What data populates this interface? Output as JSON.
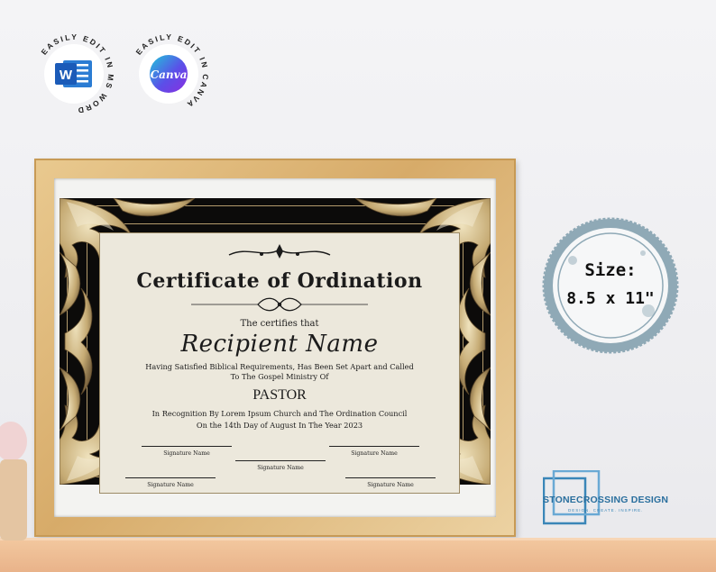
{
  "badges": [
    {
      "text": "EASILY EDIT IN MS WORD",
      "icon": "word-icon",
      "color": "#1f5fc4"
    },
    {
      "text": "EASILY EDIT IN CANVA",
      "icon": "canva-icon",
      "label": "Canva",
      "color": "#7a3ae0"
    }
  ],
  "certificate": {
    "title": "Certificate of Ordination",
    "certifies": "The certifies that",
    "recipient": "Recipient Name",
    "body_line1": "Having Satisfied Biblical Requirements, Has Been Set Apart and Called",
    "body_line2": "To The Gospel Ministry Of",
    "office": "PASTOR",
    "recognition_line1": "In Recognition By Lorem Ipsum Church and The Ordination Council",
    "recognition_line2": "On the 14th Day of August In The Year 2023",
    "signatures": [
      "Signature Name",
      "Signature Name",
      "Signature Name",
      "Signature Name",
      "Signature Name"
    ]
  },
  "size_stamp": {
    "label": "Size:",
    "value": "8.5 x 11\"",
    "color": "#8fa9b6"
  },
  "brand": {
    "name": "STONECROSSING DESIGN",
    "tagline": "DESIGN. CREATE. INSPIRE.",
    "color": "#2a6f9e"
  }
}
